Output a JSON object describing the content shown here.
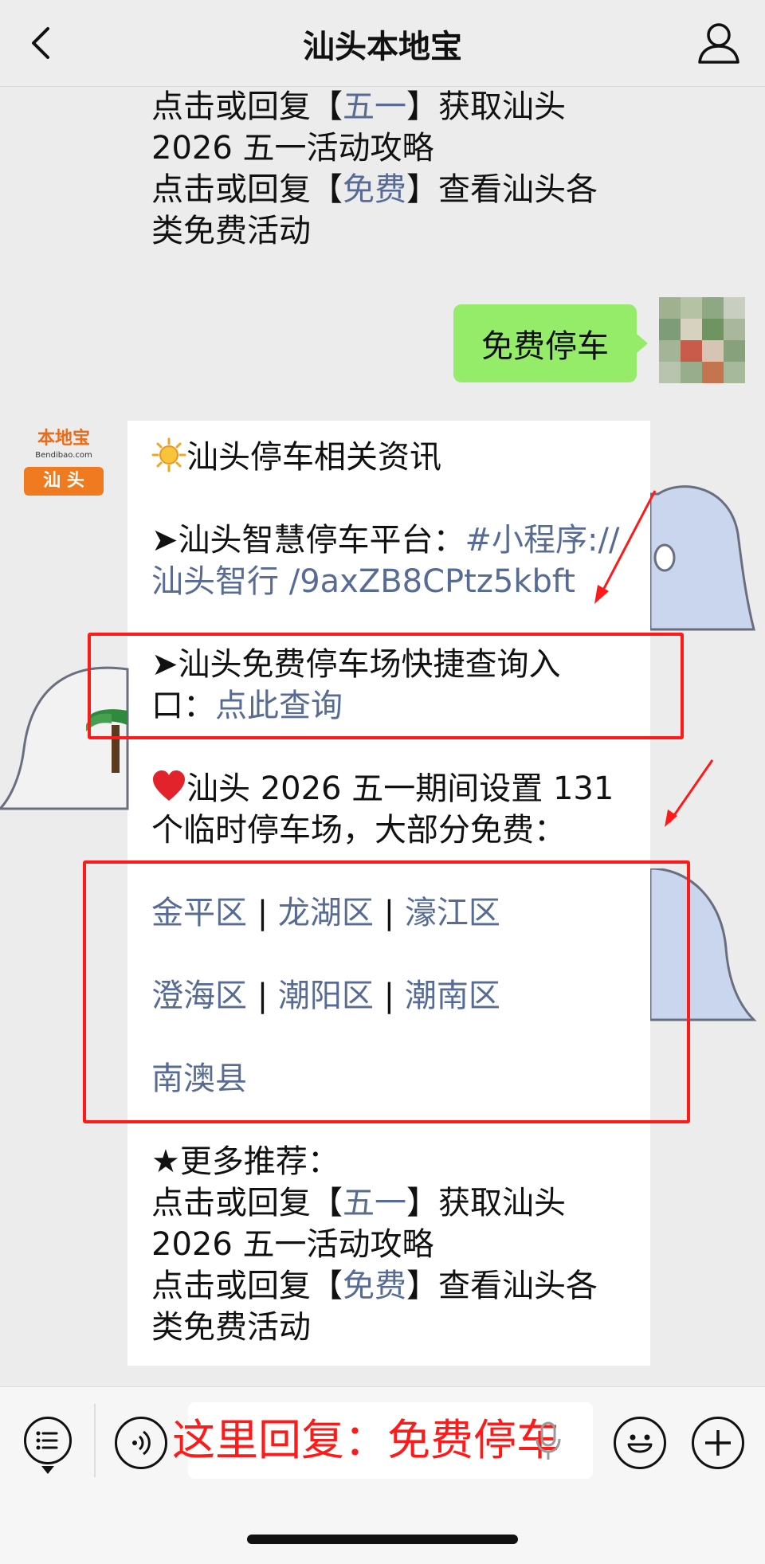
{
  "header": {
    "title": "汕头本地宝",
    "back_icon": "chevron-left-icon",
    "profile_icon": "person-icon"
  },
  "top_message": {
    "line1_pre": "点击或回复【",
    "line1_link": "五一",
    "line1_post": "】获取汕头",
    "line2": "2026 五一活动攻略",
    "line3_pre": "点击或回复【",
    "line3_link": "免费",
    "line3_post": "】查看汕头各",
    "line4": "类免费活动"
  },
  "user_message": {
    "text": "免费停车"
  },
  "account": {
    "brand_top": "本地宝",
    "brand_sub": "Bendibao.com",
    "brand_city": "汕 头"
  },
  "bot_message": {
    "heading": "汕头停车相关资讯",
    "heading_icon": "sun-icon",
    "smart_parking_label": "➤汕头智慧停车平台：",
    "smart_parking_link_1": "#小程序://",
    "smart_parking_link_2": "汕头智行 /9axZB8CPtz5kbft",
    "free_lot_line1": "➤汕头免费停车场快捷查询入",
    "free_lot_line2_pre": "口：",
    "free_lot_link": "点此查询",
    "holiday_icon": "heart-icon",
    "holiday_line1": "汕头 2026 五一期间设置 131",
    "holiday_line2": "个临时停车场，大部分免费：",
    "districts_row1": [
      "金平区",
      "龙湖区",
      "濠江区"
    ],
    "districts_row2": [
      "澄海区",
      "潮阳区",
      "潮南区"
    ],
    "districts_row3": [
      "南澳县"
    ],
    "separator": "|",
    "more_label": "★更多推荐：",
    "more_line1_pre": "点击或回复【",
    "more_line1_link": "五一",
    "more_line1_post": "】获取汕头",
    "more_line2": "2026 五一活动攻略",
    "more_line3_pre": "点击或回复【",
    "more_line3_link": "免费",
    "more_line3_post": "】查看汕头各",
    "more_line4": "类免费活动"
  },
  "input_bar": {
    "annotation": "这里回复：免费停车",
    "menu_icon": "menu-list-icon",
    "voice_icon": "voice-icon",
    "mic_icon": "microphone-icon",
    "emoji_icon": "emoji-icon",
    "plus_icon": "plus-icon"
  },
  "colors": {
    "link": "#576b95",
    "bubble_green": "#95ec69",
    "annotation_red": "#ff1a1a",
    "brand_orange": "#f07a1f"
  }
}
